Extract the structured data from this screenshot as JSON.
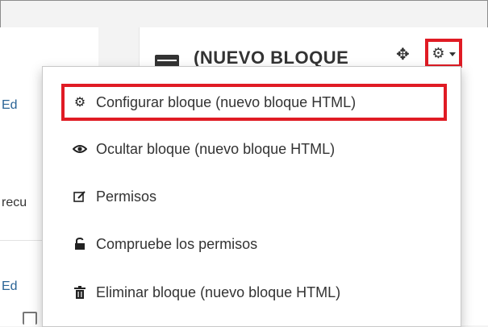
{
  "background": {
    "left_texts": [
      "Ed",
      "recu",
      "Ed"
    ]
  },
  "block": {
    "title": "(NUEVO BLOQUE",
    "move_icon": "move-icon",
    "gear_icon": "gear-icon"
  },
  "menu": {
    "items": [
      {
        "icon": "gear-icon",
        "label": "Configurar bloque (nuevo bloque HTML)",
        "highlighted": true
      },
      {
        "icon": "eye-icon",
        "label": "Ocultar bloque (nuevo bloque HTML)",
        "highlighted": false
      },
      {
        "icon": "edit-icon",
        "label": "Permisos",
        "highlighted": false
      },
      {
        "icon": "unlock-icon",
        "label": "Compruebe los permisos",
        "highlighted": false
      },
      {
        "icon": "trash-icon",
        "label": "Eliminar bloque (nuevo bloque HTML)",
        "highlighted": false
      }
    ]
  },
  "colors": {
    "highlight": "#e01b24",
    "link": "#2a6496"
  }
}
